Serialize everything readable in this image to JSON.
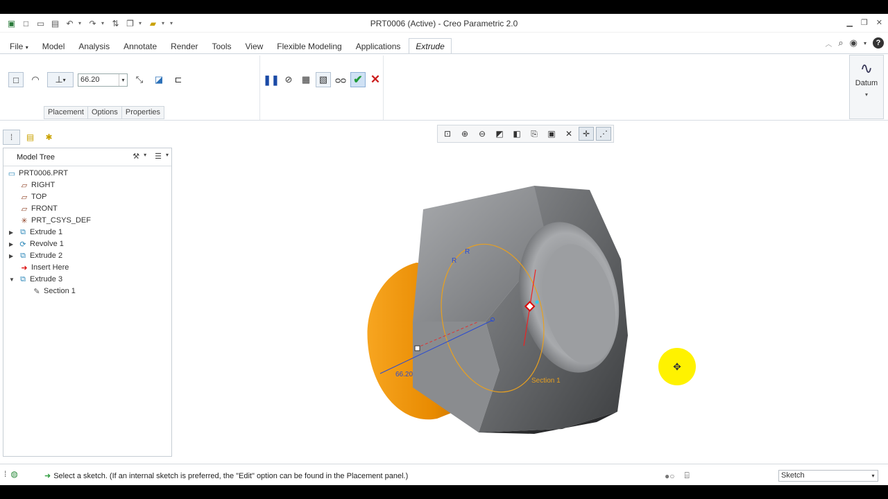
{
  "window": {
    "title": "PRT0006 (Active) - Creo Parametric 2.0"
  },
  "ribbon": {
    "tabs": [
      "File",
      "Model",
      "Analysis",
      "Annotate",
      "Render",
      "Tools",
      "View",
      "Flexible Modeling",
      "Applications",
      "Extrude"
    ],
    "active_tab": "Extrude"
  },
  "dashboard": {
    "depth_value": "66.20",
    "panel_tabs": [
      "Placement",
      "Options",
      "Properties"
    ],
    "datum_label": "Datum"
  },
  "model_tree": {
    "header": "Model Tree",
    "items": [
      {
        "label": "PRT0006.PRT",
        "icon": "part-icon"
      },
      {
        "label": "RIGHT",
        "icon": "datum-plane-icon"
      },
      {
        "label": "TOP",
        "icon": "datum-plane-icon"
      },
      {
        "label": "FRONT",
        "icon": "datum-plane-icon"
      },
      {
        "label": "PRT_CSYS_DEF",
        "icon": "csys-icon"
      },
      {
        "label": "Extrude 1",
        "icon": "extrude-icon"
      },
      {
        "label": "Revolve 1",
        "icon": "revolve-icon"
      },
      {
        "label": "Extrude 2",
        "icon": "extrude-icon"
      },
      {
        "label": "Insert Here",
        "icon": "insert-arrow-icon"
      },
      {
        "label": "Extrude 3",
        "icon": "extrude-icon"
      },
      {
        "label": "Section 1",
        "icon": "sketch-icon"
      }
    ]
  },
  "viewport": {
    "dimension_label": "66.20",
    "section_label": "Section 1",
    "radius_label_1": "R",
    "radius_label_2": "R"
  },
  "status_bar": {
    "message": "Select a sketch. (If an internal sketch is preferred, the \"Edit\" option can be found in the Placement panel.)",
    "filter_value": "Sketch"
  }
}
